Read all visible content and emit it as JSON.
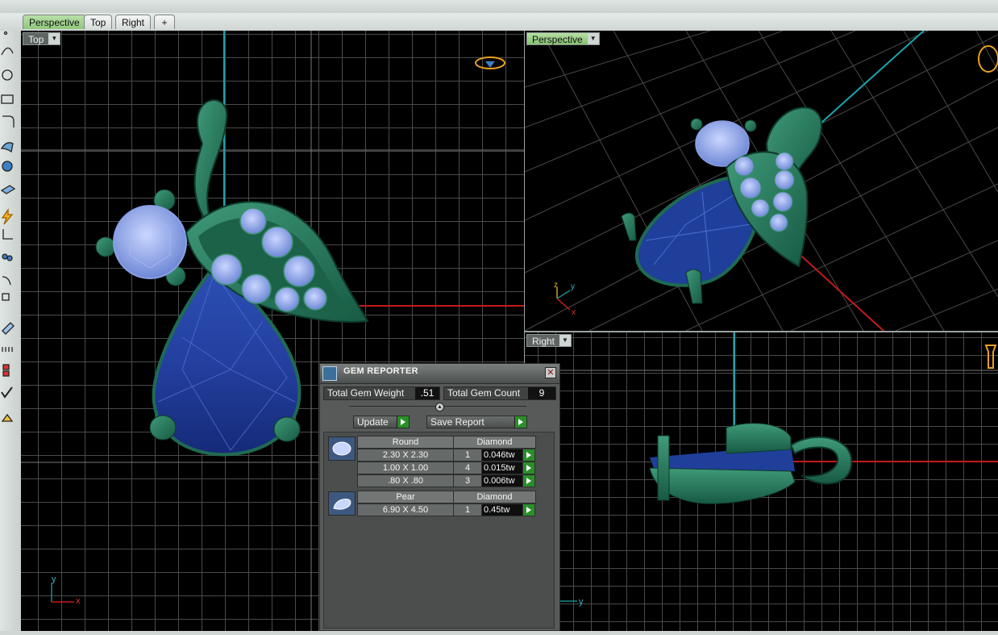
{
  "tabs": [
    "Perspective",
    "Top",
    "Right"
  ],
  "tab_add_icon": "plus-icon",
  "viewports": {
    "top": {
      "label": "Top"
    },
    "perspective": {
      "label": "Perspective"
    },
    "right": {
      "label": "Right"
    }
  },
  "axis_labels": {
    "x": "x",
    "y": "y",
    "z": "z"
  },
  "colors": {
    "metal": "#1f6b52",
    "metal_light": "#3f9a78",
    "sapphire": "#1f3f9a",
    "diamond": "#8fa6e6",
    "x_axis": "#c31b1b",
    "z_axis": "#1aa6b0"
  },
  "gem_reporter": {
    "title": "GEM REPORTER",
    "total_weight_label": "Total Gem Weight",
    "total_weight_value": ".51",
    "total_count_label": "Total Gem Count",
    "total_count_value": "9",
    "update_label": "Update",
    "save_report_label": "Save Report",
    "groups": [
      {
        "shape": "Round",
        "material": "Diamond",
        "rows": [
          {
            "size": "2.30 X 2.30",
            "count": "1",
            "weight": "0.046tw"
          },
          {
            "size": "1.00 X 1.00",
            "count": "4",
            "weight": "0.015tw"
          },
          {
            "size": ".80 X .80",
            "count": "3",
            "weight": "0.006tw"
          }
        ]
      },
      {
        "shape": "Pear",
        "material": "Diamond",
        "rows": [
          {
            "size": "6.90 X 4.50",
            "count": "1",
            "weight": "0.45tw"
          }
        ]
      }
    ]
  }
}
